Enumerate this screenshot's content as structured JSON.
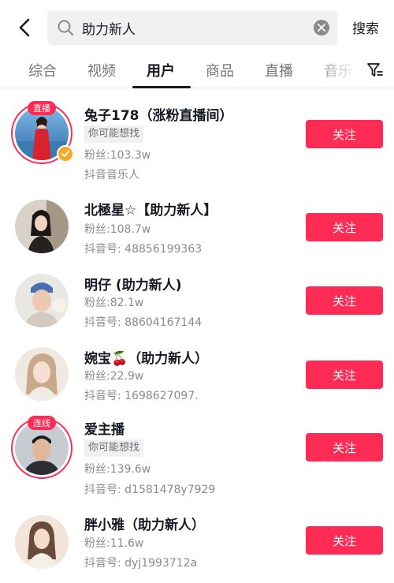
{
  "search": {
    "query": "助力新人",
    "button_label": "搜索"
  },
  "tabs": [
    {
      "label": "综合"
    },
    {
      "label": "视频"
    },
    {
      "label": "用户"
    },
    {
      "label": "商品"
    },
    {
      "label": "直播"
    },
    {
      "label": "音乐"
    }
  ],
  "active_tab": "用户",
  "colors": {
    "accent": "#fe2c55",
    "verified": "#f7a928"
  },
  "results": [
    {
      "name": "兔子178（涨粉直播间）",
      "badge": "直播",
      "tag": "你可能想找",
      "fans": "粉丝:103.3w",
      "detail": "抖音音乐人",
      "verified": true,
      "follow_label": "关注"
    },
    {
      "name": "北極星☆【助力新人】",
      "fans": "粉丝:108.7w",
      "detail": "抖音号: 48856199363",
      "follow_label": "关注"
    },
    {
      "name": "明仔 (助力新人)",
      "fans": "粉丝:82.1w",
      "detail": "抖音号: 88604167144",
      "follow_label": "关注"
    },
    {
      "name": "婉宝🍒（助力新人）",
      "fans": "粉丝:22.9w",
      "detail": "抖音号: 1698627097.",
      "follow_label": "关注"
    },
    {
      "name": "爱主播",
      "badge": "连线",
      "tag": "你可能想找",
      "fans": "粉丝:139.6w",
      "detail": "抖音号: d1581478y7929",
      "follow_label": "关注"
    },
    {
      "name": "胖小雅（助力新人）",
      "fans": "粉丝:11.6w",
      "detail": "抖音号: dyj1993712a",
      "follow_label": "关注"
    }
  ]
}
